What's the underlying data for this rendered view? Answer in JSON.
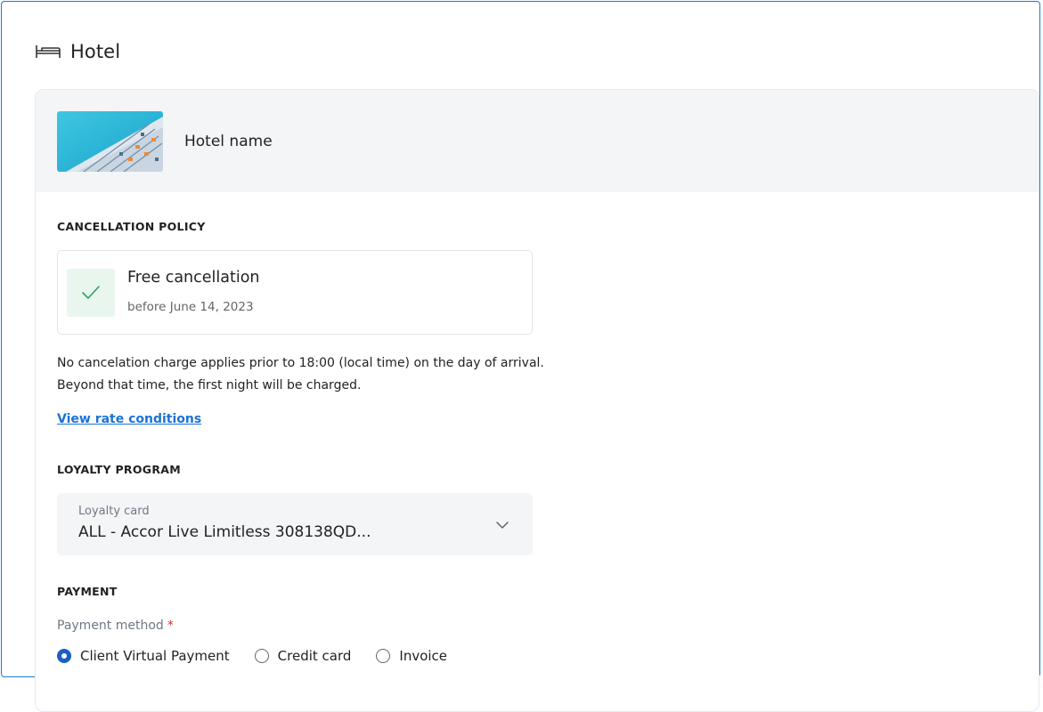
{
  "section": {
    "title": "Hotel",
    "icon": "bed-icon"
  },
  "hotel": {
    "name": "Hotel name",
    "image_icon": "hotel-photo"
  },
  "cancellation": {
    "heading": "CANCELLATION POLICY",
    "badge_icon": "check-icon",
    "title": "Free cancellation",
    "subtitle": "before June 14, 2023",
    "text_line1": "No cancelation charge applies prior to 18:00 (local time) on the day of arrival.",
    "text_line2": "Beyond that time, the first night will be charged.",
    "link": "View rate conditions"
  },
  "loyalty": {
    "heading": "LOYALTY PROGRAM",
    "field_label": "Loyalty card",
    "value": "ALL - Accor Live Limitless 308138QD...",
    "chevron_icon": "chevron-down-icon"
  },
  "payment": {
    "heading": "PAYMENT",
    "method_label": "Payment method",
    "required_mark": "*",
    "options": [
      {
        "label": "Client Virtual Payment",
        "selected": true
      },
      {
        "label": "Credit card",
        "selected": false
      },
      {
        "label": "Invoice",
        "selected": false
      }
    ]
  },
  "colors": {
    "accent": "#1a73d6",
    "frame_border": "#1f77c9",
    "success_bg": "#e8f6ee",
    "success": "#2f9e62",
    "required": "#d9302c"
  }
}
